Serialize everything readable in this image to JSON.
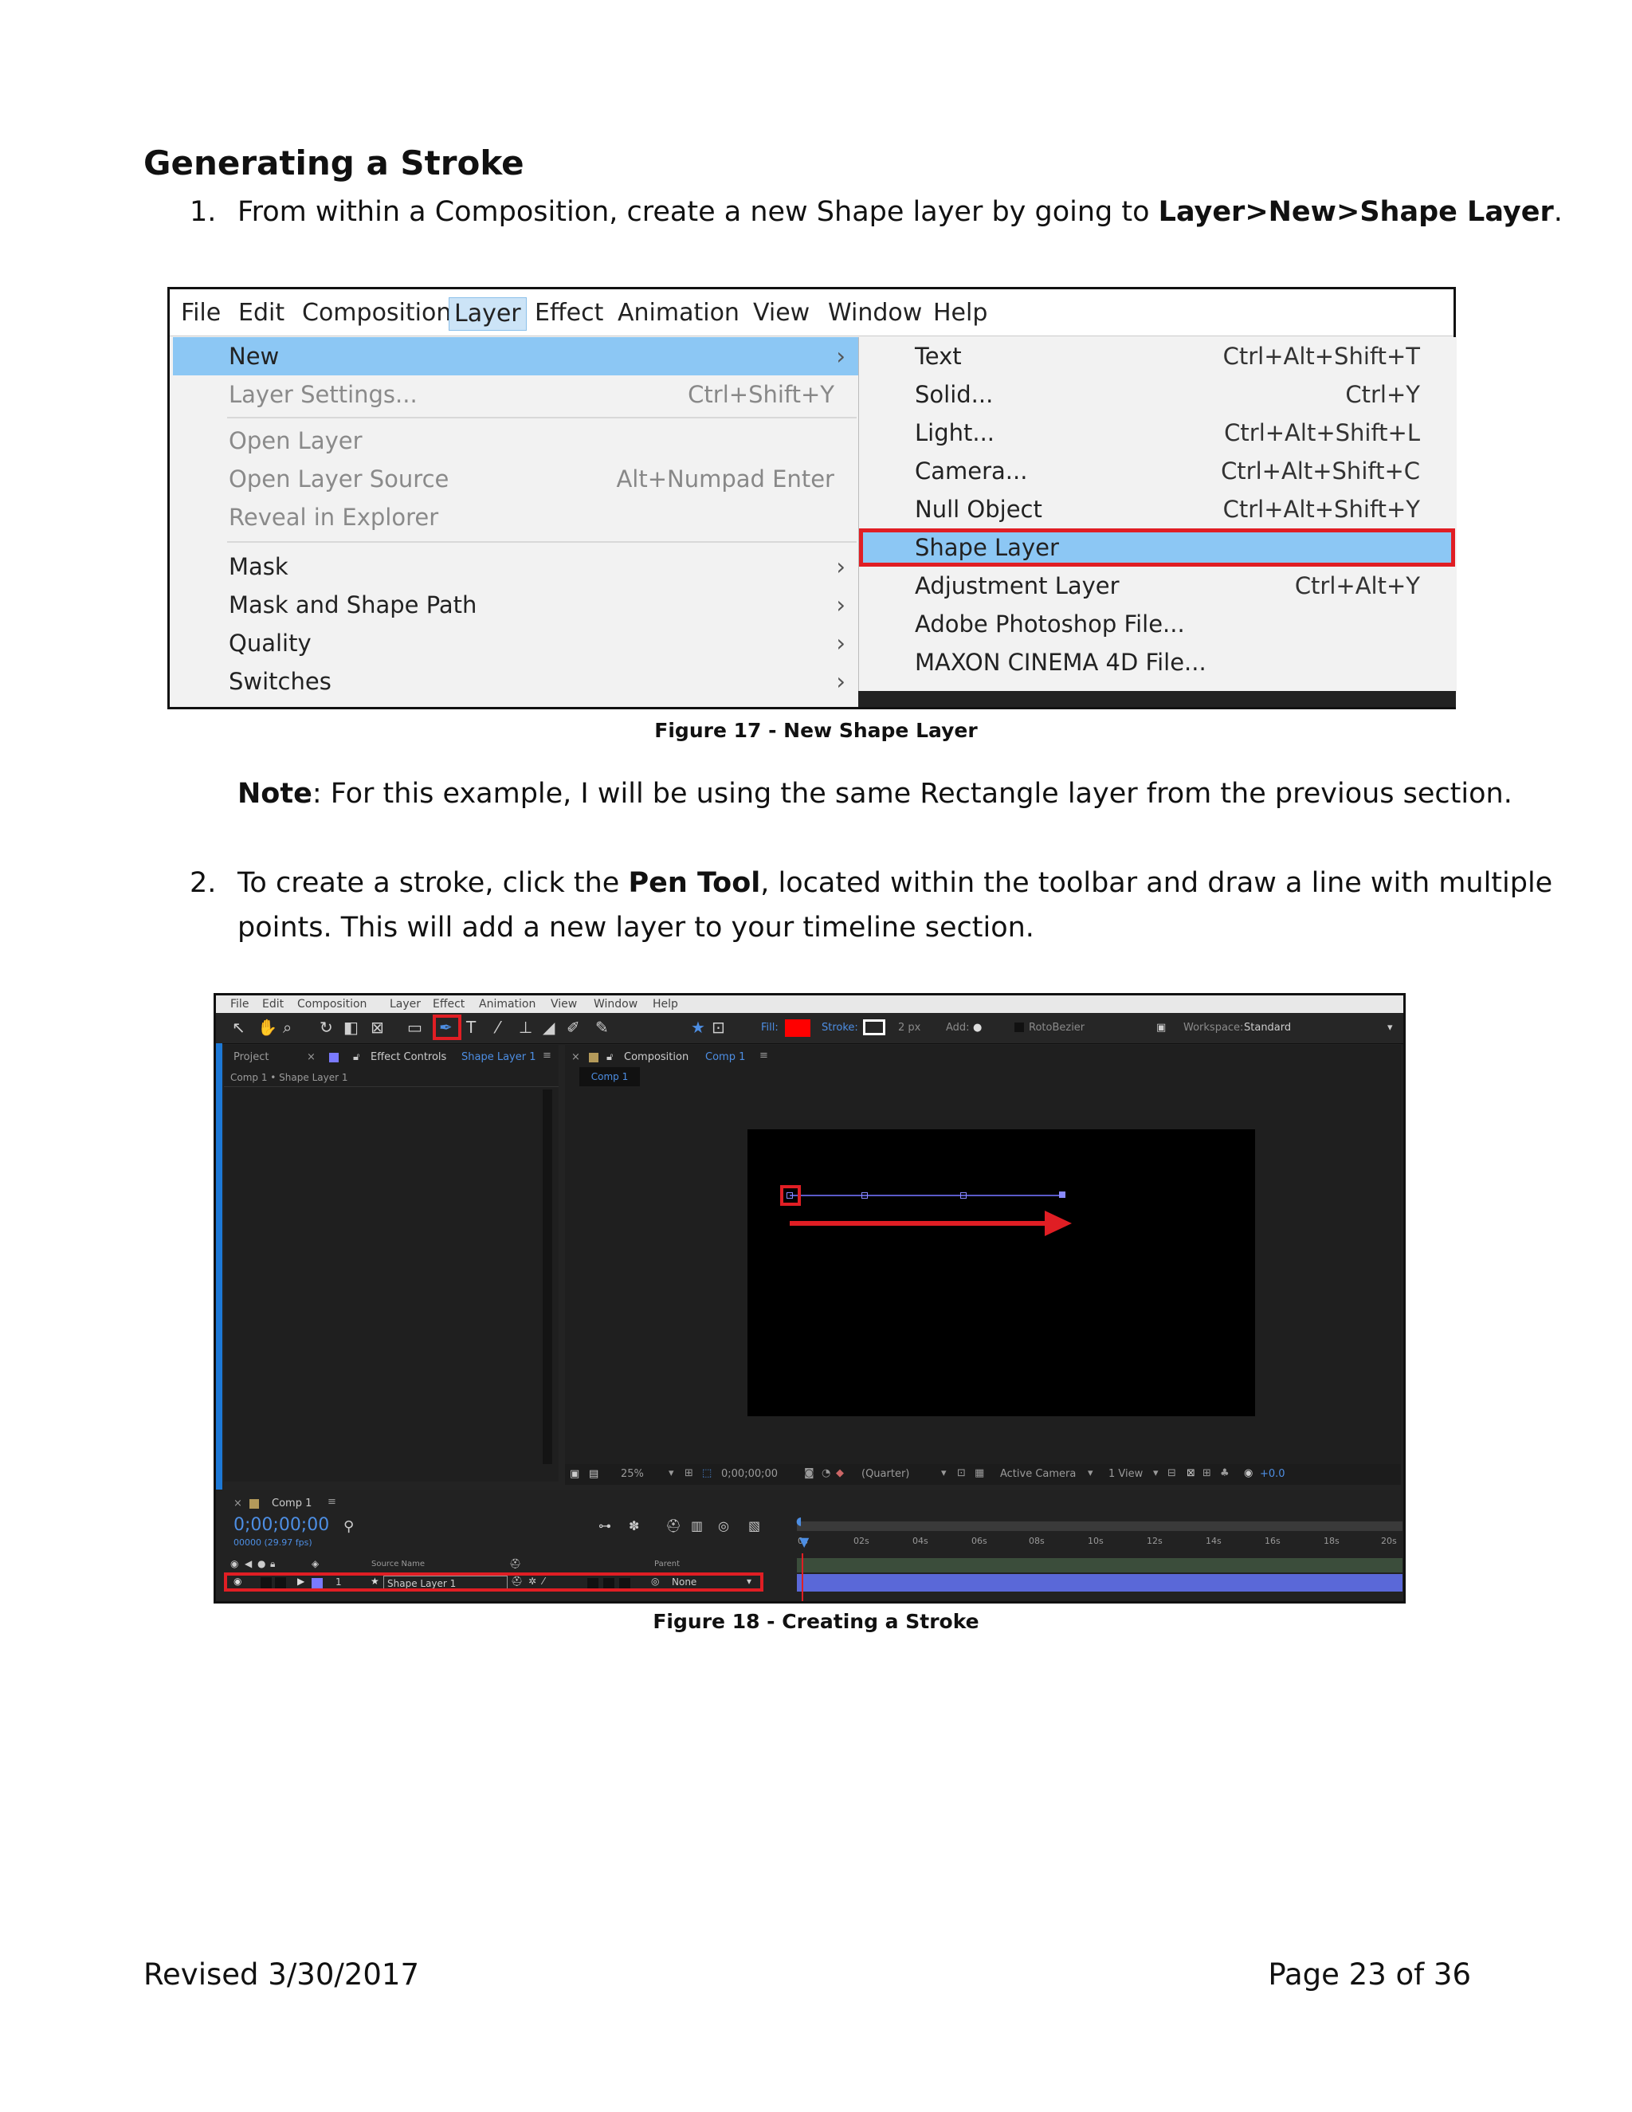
{
  "heading": "Generating a Stroke",
  "step1": {
    "num": "1.",
    "text_before": "From within a Composition, create a new Shape layer by going to ",
    "bold": "Layer>New>Shape Layer",
    "text_after": "."
  },
  "figure17": {
    "menubar": [
      "File",
      "Edit",
      "Composition",
      "Layer",
      "Effect",
      "Animation",
      "View",
      "Window",
      "Help"
    ],
    "active_menu": "Layer",
    "left_menu": [
      {
        "label": "New",
        "shortcut": "",
        "arrow": "›",
        "disabled": false,
        "highlighted": true
      },
      {
        "label": "Layer Settings...",
        "shortcut": "Ctrl+Shift+Y",
        "arrow": "",
        "disabled": true,
        "highlighted": false
      },
      {
        "label": "Open Layer",
        "shortcut": "",
        "arrow": "",
        "disabled": true,
        "highlighted": false
      },
      {
        "label": "Open Layer Source",
        "shortcut": "Alt+Numpad Enter",
        "arrow": "",
        "disabled": true,
        "highlighted": false
      },
      {
        "label": "Reveal in Explorer",
        "shortcut": "",
        "arrow": "",
        "disabled": true,
        "highlighted": false
      },
      {
        "label": "Mask",
        "shortcut": "",
        "arrow": "›",
        "disabled": false,
        "highlighted": false
      },
      {
        "label": "Mask and Shape Path",
        "shortcut": "",
        "arrow": "›",
        "disabled": false,
        "highlighted": false
      },
      {
        "label": "Quality",
        "shortcut": "",
        "arrow": "›",
        "disabled": false,
        "highlighted": false
      },
      {
        "label": "Switches",
        "shortcut": "",
        "arrow": "›",
        "disabled": false,
        "highlighted": false
      }
    ],
    "submenu": [
      {
        "label": "Text",
        "shortcut": "Ctrl+Alt+Shift+T"
      },
      {
        "label": "Solid...",
        "shortcut": "Ctrl+Y"
      },
      {
        "label": "Light...",
        "shortcut": "Ctrl+Alt+Shift+L"
      },
      {
        "label": "Camera...",
        "shortcut": "Ctrl+Alt+Shift+C"
      },
      {
        "label": "Null Object",
        "shortcut": "Ctrl+Alt+Shift+Y"
      },
      {
        "label": "Shape Layer",
        "shortcut": ""
      },
      {
        "label": "Adjustment Layer",
        "shortcut": "Ctrl+Alt+Y"
      },
      {
        "label": "Adobe Photoshop File...",
        "shortcut": ""
      },
      {
        "label": "MAXON CINEMA 4D File...",
        "shortcut": ""
      }
    ],
    "caption": "Figure 17 - New Shape Layer"
  },
  "note": {
    "bold": "Note",
    "text": ": For this example, I will be using the same Rectangle layer from the previous section."
  },
  "step2": {
    "num": "2.",
    "text_before": "To create a stroke, click the ",
    "bold": "Pen Tool",
    "text_after": ", located within the toolbar and draw a line with multiple",
    "line2": "points. This will add a new layer to your timeline section."
  },
  "figure18": {
    "menubar": [
      "File",
      "Edit",
      "Composition",
      "Layer",
      "Effect",
      "Animation",
      "View",
      "Window",
      "Help"
    ],
    "toolbar": {
      "fill_label": "Fill:",
      "stroke_label": "Stroke:",
      "stroke_width": "2 px",
      "add_label": "Add:",
      "rotobezier": "RotoBezier",
      "workspace_label": "Workspace:",
      "workspace": "Standard"
    },
    "left_panel": {
      "tab_project": "Project",
      "tab_effect": "Effect Controls",
      "tab_effect_layer": "Shape Layer 1",
      "breadcrumb": "Comp 1 • Shape Layer 1"
    },
    "comp_panel": {
      "tab": "Composition",
      "tab_comp": "Comp 1",
      "chip": "Comp 1"
    },
    "viewer_bar": {
      "zoom": "25%",
      "timecode": "0;00;00;00",
      "resolution": "(Quarter)",
      "camera": "Active Camera",
      "view": "1 View",
      "exposure": "+0.0"
    },
    "timeline": {
      "tab": "Comp 1",
      "timecode": "0;00;00;00",
      "fps": "00000 (29.97 fps)",
      "col_source": "Source Name",
      "col_parent": "Parent",
      "layer_num": "1",
      "layer_name": "Shape Layer 1",
      "parent_value": "None",
      "ruler_ticks": [
        "0s",
        "02s",
        "04s",
        "06s",
        "08s",
        "10s",
        "12s",
        "14s",
        "16s",
        "18s",
        "20s"
      ]
    },
    "colors": {
      "fill": "#ff0000",
      "highlight_box": "#e01e24",
      "menu_highlight": "#8cc7f4",
      "track": "#5a68d8"
    },
    "caption": "Figure 18 - Creating a Stroke"
  },
  "footer": {
    "left": "Revised 3/30/2017",
    "right": "Page 23 of 36"
  }
}
